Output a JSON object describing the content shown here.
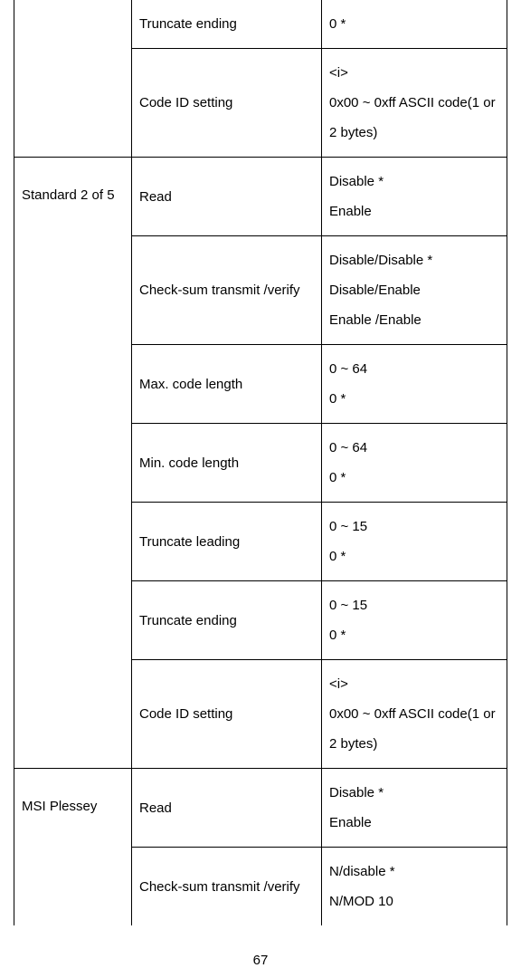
{
  "table": {
    "prev_group": {
      "rows": [
        {
          "param": "Truncate ending",
          "value": "0 *"
        },
        {
          "param": "Code ID setting",
          "value": "<i>\n0x00 ~ 0xff ASCII code(1 or 2 bytes)"
        }
      ]
    },
    "std25": {
      "label": "Standard 2 of 5",
      "rows": [
        {
          "param": "Read",
          "value": "Disable *\nEnable"
        },
        {
          "param": "Check-sum transmit /verify",
          "value": "Disable/Disable *\nDisable/Enable\nEnable /Enable"
        },
        {
          "param": "Max. code length",
          "value": "0 ~ 64\n0 *"
        },
        {
          "param": "Min. code length",
          "value": "0 ~ 64\n0 *"
        },
        {
          "param": "Truncate leading",
          "value": "0 ~ 15\n0 *"
        },
        {
          "param": "Truncate ending",
          "value": "0 ~ 15\n0 *"
        },
        {
          "param": "Code ID setting",
          "value": "<i>\n0x00 ~ 0xff ASCII code(1 or 2 bytes)"
        }
      ]
    },
    "msi": {
      "label": "MSI Plessey",
      "rows": [
        {
          "param": "Read",
          "value": "Disable *\nEnable"
        },
        {
          "param": "Check-sum transmit /verify",
          "value": "N/disable *\nN/MOD 10"
        }
      ]
    }
  },
  "page_number": "67"
}
